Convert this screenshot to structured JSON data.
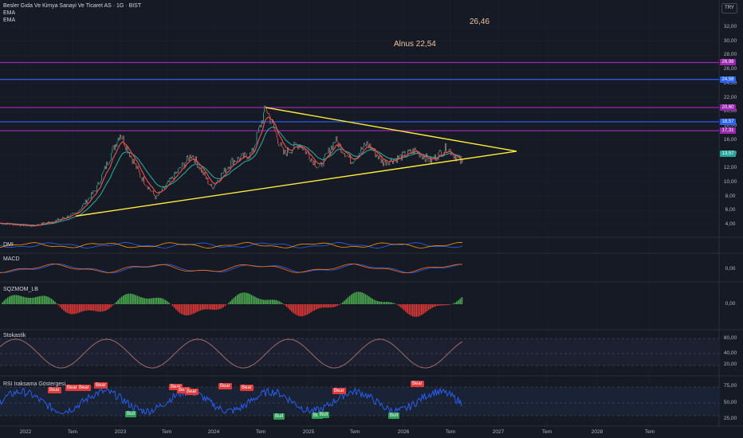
{
  "legend": {
    "symbol_line": "Besler Gıda Ve Kimya Sanayi Ve Ticaret AS · 1G · BIST",
    "indicators": [
      "EMA",
      "EMA"
    ]
  },
  "currency": "TRY",
  "annotations": {
    "target_high": "26,46",
    "buy_level": "Alnus 22,54"
  },
  "price_axis": {
    "ticks": [
      "32,00",
      "30,00",
      "28,00",
      "26,00",
      "24,00",
      "22,00",
      "20,00",
      "18,00",
      "16,00",
      "14,00",
      "12,00",
      "10,00",
      "8,00",
      "6,00",
      "4,00"
    ]
  },
  "horizontal_levels": [
    {
      "value": "26,98",
      "color": "#9c27b0"
    },
    {
      "value": "24,58",
      "color": "#2962ff"
    },
    {
      "value": "20,60",
      "color": "#9c27b0"
    },
    {
      "value": "18,57",
      "color": "#2962ff"
    },
    {
      "value": "17,31",
      "color": "#9c27b0"
    }
  ],
  "last_price": {
    "value": "13,57",
    "color": "#26a69a"
  },
  "panes": {
    "dmi": {
      "title": "DMI"
    },
    "macd": {
      "title": "MACD",
      "ticks": [
        "0,00"
      ]
    },
    "momentum": {
      "title": "SQZMOM_LB",
      "ticks": [
        "0,00"
      ]
    },
    "stochastic": {
      "title": "Stokastik",
      "ticks": [
        "80,00",
        "40,00",
        "20,00"
      ]
    },
    "rsi": {
      "title": "RSI Iraksama Göstergesi",
      "ticks": [
        "75,00",
        "50,00",
        "25,00"
      ],
      "bear_labels": [
        "Bear",
        "Bear",
        "Bear",
        "Bear",
        "Bear",
        "Bear",
        "Bear",
        "Bear",
        "Bear",
        "Bear",
        "Bear"
      ],
      "bull_labels": [
        "Bull",
        "Bull",
        "Bull",
        "Bull",
        "Bull"
      ]
    }
  },
  "time_axis": [
    "2022",
    "Tem",
    "2023",
    "Tem",
    "2024",
    "Tem",
    "2025",
    "Tem",
    "2026",
    "Tem",
    "2027",
    "Tem",
    "2028",
    "Tem"
  ],
  "colors": {
    "background": "#161a25",
    "ema_fast": "#ef5350",
    "ema_slow": "#26a69a",
    "trendline": "#ffeb3b",
    "candle_up": "#26a69a",
    "candle_down": "#ef5350",
    "rsi_line": "#2962ff",
    "stoch_line": "#a26a6a",
    "mom_up": "#4caf50",
    "mom_down": "#e53935"
  }
}
